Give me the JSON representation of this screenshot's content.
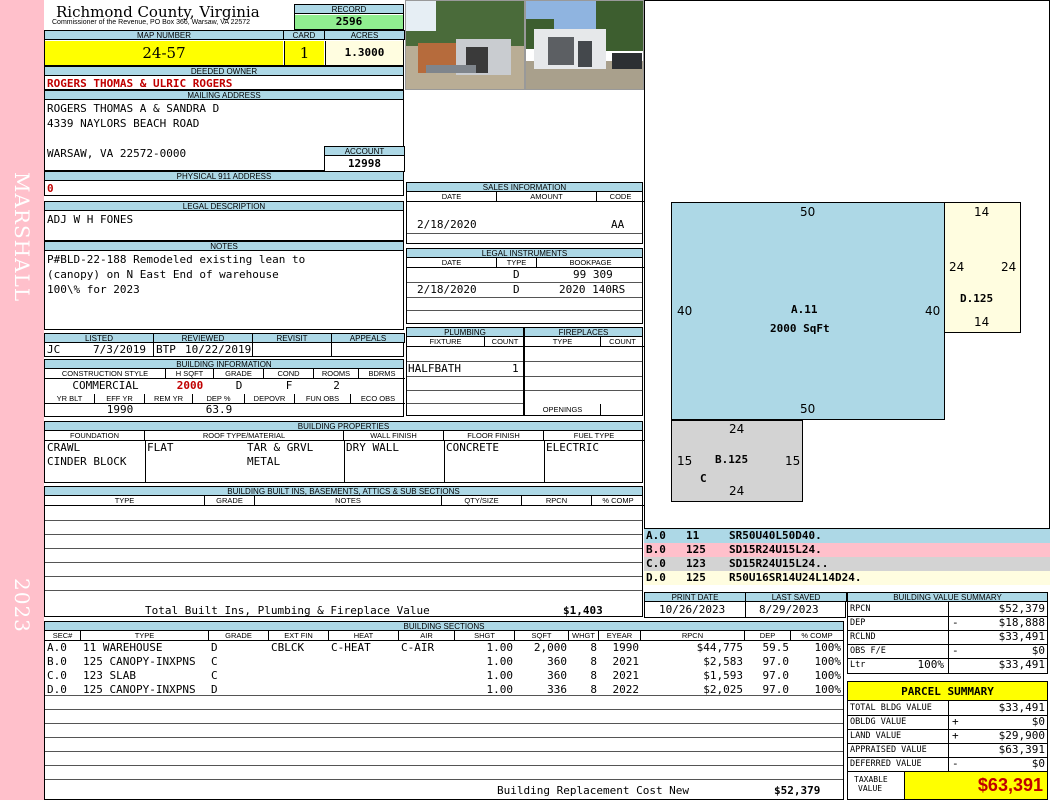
{
  "sidebar": {
    "district": "MARSHALL",
    "year": "2023"
  },
  "header": {
    "county": "Richmond County, Virginia",
    "office": "Commissioner of the Revenue, PO Box 366, Warsaw, VA 22572",
    "record_label": "RECORD",
    "record": "2596",
    "map_label": "MAP NUMBER",
    "map_number": "24-57",
    "card_label": "CARD",
    "card": "1",
    "acres_label": "ACRES",
    "acres": "1.3000"
  },
  "owner": {
    "deeded_label": "DEEDED OWNER",
    "deeded_owner": "ROGERS THOMAS & ULRIC ROGERS",
    "mailing_label": "MAILING ADDRESS",
    "mailing_lines": [
      "ROGERS THOMAS A & SANDRA D",
      "4339 NAYLORS BEACH ROAD",
      "WARSAW, VA 22572-0000"
    ],
    "account_label": "ACCOUNT",
    "account": "12998",
    "physical_label": "PHYSICAL 911 ADDRESS",
    "physical": "0"
  },
  "legal": {
    "label": "LEGAL DESCRIPTION",
    "text": "ADJ W H FONES"
  },
  "notes": {
    "label": "NOTES",
    "lines": [
      "P#BLD-22-188 Remodeled existing lean to",
      "(canopy) on N East End of warehouse",
      "100\\% for 2023"
    ]
  },
  "review": {
    "headers": [
      "LISTED",
      "REVIEWED",
      "REVISIT",
      "APPEALS"
    ],
    "listed_by": "JC",
    "listed_date": "7/3/2019",
    "reviewed_by": "BTP",
    "reviewed_date": "10/22/2019"
  },
  "building_info": {
    "label": "BUILDING INFORMATION",
    "headers": [
      "CONSTRUCTION STYLE",
      "H SQFT",
      "GRADE",
      "COND",
      "ROOMS",
      "BDRMS"
    ],
    "values": [
      "COMMERCIAL",
      "2000",
      "D",
      "F",
      "2",
      ""
    ],
    "headers2": [
      "YR BLT",
      "EFF YR",
      "REM YR",
      "DEP %",
      "DEPOVR",
      "FUN OBS",
      "ECO OBS"
    ],
    "values2": [
      "",
      "1990",
      "",
      "63.9",
      "",
      "",
      ""
    ]
  },
  "sales": {
    "label": "SALES INFORMATION",
    "headers": [
      "DATE",
      "AMOUNT",
      "CODE"
    ],
    "rows": [
      {
        "date": "2/18/2020",
        "amount": "",
        "code": "AA"
      }
    ]
  },
  "legal_instruments": {
    "label": "LEGAL INSTRUMENTS",
    "headers": [
      "DATE",
      "TYPE",
      "BOOKPAGE"
    ],
    "rows": [
      {
        "date": "",
        "type": "D",
        "book": "99 309"
      },
      {
        "date": "2/18/2020",
        "type": "D",
        "book": "2020 140RS"
      }
    ]
  },
  "plumbing": {
    "label": "PLUMBING",
    "headers": [
      "FIXTURE",
      "COUNT"
    ],
    "fixture": "HALFBATH",
    "count": "1"
  },
  "fireplaces": {
    "label": "FIREPLACES",
    "headers": [
      "TYPE",
      "COUNT"
    ],
    "openings_label": "OPENINGS"
  },
  "properties": {
    "label": "BUILDING PROPERTIES",
    "headers": [
      "FOUNDATION",
      "ROOF TYPE/MATERIAL",
      "WALL FINISH",
      "FLOOR FINISH",
      "FUEL TYPE"
    ],
    "foundation": [
      "CRAWL",
      "CINDER BLOCK"
    ],
    "roof_type": "FLAT",
    "roof_material": [
      "TAR & GRVL",
      "METAL"
    ],
    "wall": "DRY WALL",
    "floor": "CONCRETE",
    "fuel": "ELECTRIC"
  },
  "builtins": {
    "label": "BUILDING BUILT INS, BASEMENTS, ATTICS & SUB SECTIONS",
    "headers": [
      "TYPE",
      "GRADE",
      "NOTES",
      "QTY/SIZE",
      "RPCN",
      "% COMP"
    ],
    "total_label": "Total Built Ins, Plumbing & Fireplace Value",
    "total_value": "$1,403"
  },
  "print": {
    "print_label": "PRINT DATE",
    "print_date": "10/26/2023",
    "saved_label": "LAST SAVED",
    "saved_date": "8/29/2023"
  },
  "sketch": {
    "A": {
      "label": "A.11",
      "area": "2000 SqFt",
      "top": "50",
      "bottom": "50",
      "left": "40",
      "right": "40"
    },
    "D": {
      "label": "D.125",
      "top": "14",
      "bottom": "14",
      "left": "24",
      "right": "24"
    },
    "B": {
      "label": "B.125",
      "sub": "C",
      "top": "24",
      "bottom": "24",
      "left": "15",
      "right": "15"
    },
    "legend": [
      {
        "id": "A.0",
        "code": "11",
        "vec": "SR50U40L50D40.",
        "color": "#add8e6"
      },
      {
        "id": "B.0",
        "code": "125",
        "vec": "SD15R24U15L24.",
        "color": "#ffc0cb"
      },
      {
        "id": "C.0",
        "code": "123",
        "vec": "SD15R24U15L24..",
        "color": "#d3d3d3"
      },
      {
        "id": "D.0",
        "code": "125",
        "vec": "R50U16SR14U24L14D24.",
        "color": "#fffde0"
      }
    ]
  },
  "bvs": {
    "label": "BUILDING VALUE SUMMARY",
    "rows": [
      {
        "k": "RPCN",
        "pct": "",
        "sign": "",
        "v": "$52,379"
      },
      {
        "k": "DEP",
        "pct": "",
        "sign": "-",
        "v": "$18,888"
      },
      {
        "k": "RCLND",
        "pct": "",
        "sign": "",
        "v": "$33,491"
      },
      {
        "k": "OBS F/E",
        "pct": "",
        "sign": "-",
        "v": "$0"
      },
      {
        "k": "Ltr",
        "pct": "100%",
        "sign": "",
        "v": "$33,491"
      }
    ]
  },
  "parcel": {
    "label": "PARCEL SUMMARY",
    "rows": [
      {
        "k": "TOTAL BLDG VALUE",
        "sign": "",
        "v": "$33,491"
      },
      {
        "k": "OBLDG VALUE",
        "sign": "+",
        "v": "$0"
      },
      {
        "k": "LAND VALUE",
        "sign": "+",
        "v": "$29,900"
      },
      {
        "k": "APPRAISED VALUE",
        "sign": "",
        "v": "$63,391"
      },
      {
        "k": "DEFERRED VALUE",
        "sign": "-",
        "v": "$0"
      }
    ],
    "taxable_label_1": "TAXABLE",
    "taxable_label_2": "VALUE",
    "taxable": "$63,391"
  },
  "sections": {
    "label": "BUILDING SECTIONS",
    "headers": [
      "SEC#",
      "TYPE",
      "GRADE",
      "EXT FIN",
      "HEAT",
      "AIR",
      "SHGT",
      "SQFT",
      "WHGT",
      "EYEAR",
      "RPCN",
      "DEP",
      "% COMP"
    ],
    "rows": [
      [
        "A.0",
        "11 WAREHOUSE",
        "D",
        "CBLCK",
        "C-HEAT",
        "C-AIR",
        "1.00",
        "2,000",
        "8",
        "1990",
        "$44,775",
        "59.5",
        "100%"
      ],
      [
        "B.0",
        "125 CANOPY-INXPNS",
        "C",
        "",
        "",
        "",
        "1.00",
        "360",
        "8",
        "2021",
        "$2,583",
        "97.0",
        "100%"
      ],
      [
        "C.0",
        "123 SLAB",
        "C",
        "",
        "",
        "",
        "1.00",
        "360",
        "8",
        "2021",
        "$1,593",
        "97.0",
        "100%"
      ],
      [
        "D.0",
        "125 CANOPY-INXPNS",
        "D",
        "",
        "",
        "",
        "1.00",
        "336",
        "8",
        "2022",
        "$2,025",
        "97.0",
        "100%"
      ]
    ],
    "brcn_label": "Building Replacement Cost New",
    "brcn": "$52,379"
  }
}
